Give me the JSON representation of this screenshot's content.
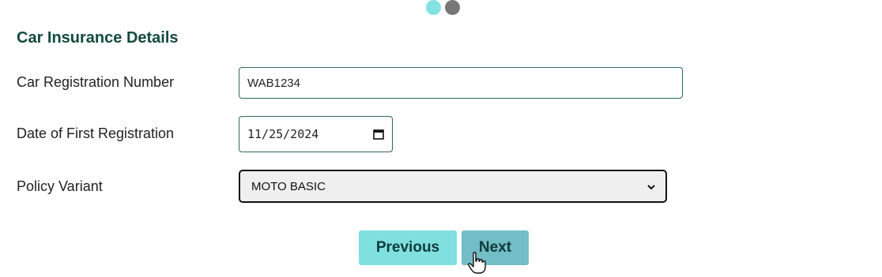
{
  "progress": {
    "steps": 2,
    "current": 1,
    "active_color": "#84e1e1",
    "inactive_color": "#777777"
  },
  "section": {
    "title": "Car Insurance Details"
  },
  "form": {
    "registration": {
      "label": "Car Registration Number",
      "value": "WAB1234"
    },
    "first_registration_date": {
      "label": "Date of First Registration",
      "value": "11/25/2024",
      "icon": "calendar-icon"
    },
    "policy_variant": {
      "label": "Policy Variant",
      "selected": "MOTO BASIC",
      "icon": "chevron-down-icon"
    }
  },
  "buttons": {
    "previous_label": "Previous",
    "next_label": "Next"
  },
  "colors": {
    "title": "#134a40",
    "input_border": "#2e6b5a",
    "previous_button": "#7fe0df",
    "next_button": "#73bdc7"
  }
}
